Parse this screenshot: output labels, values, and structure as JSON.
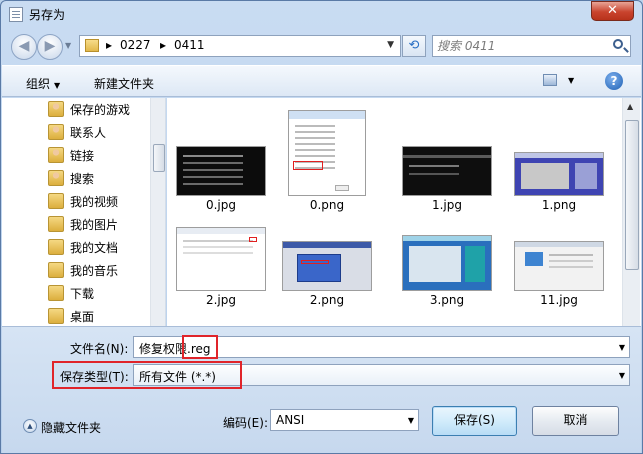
{
  "window": {
    "title": "另存为",
    "close": "✕"
  },
  "nav": {
    "back": "◀",
    "forward": "▶",
    "history_drop": "▼",
    "path": [
      "0227",
      "0411"
    ],
    "sep": "▸",
    "refresh": "⟲",
    "search_placeholder": "搜索 0411"
  },
  "toolbar": {
    "organize": "组织",
    "new_folder": "新建文件夹",
    "help": "?"
  },
  "sidebar": {
    "items": [
      {
        "label": "保存的游戏",
        "icon": "saved-games-icon"
      },
      {
        "label": "联系人",
        "icon": "contacts-icon"
      },
      {
        "label": "链接",
        "icon": "links-icon"
      },
      {
        "label": "搜索",
        "icon": "searches-icon"
      },
      {
        "label": "我的视频",
        "icon": "videos-icon"
      },
      {
        "label": "我的图片",
        "icon": "pictures-icon"
      },
      {
        "label": "我的文档",
        "icon": "documents-icon"
      },
      {
        "label": "我的音乐",
        "icon": "music-icon"
      },
      {
        "label": "下载",
        "icon": "downloads-icon"
      },
      {
        "label": "桌面",
        "icon": "desktop-icon"
      }
    ]
  },
  "files": [
    {
      "name": "0.jpg",
      "thumb": "dark"
    },
    {
      "name": "0.png",
      "thumb": "dialog"
    },
    {
      "name": "1.jpg",
      "thumb": "dark"
    },
    {
      "name": "1.png",
      "thumb": "bios"
    },
    {
      "name": "2.jpg",
      "thumb": "white"
    },
    {
      "name": "2.png",
      "thumb": "bluewin"
    },
    {
      "name": "3.png",
      "thumb": "setup"
    },
    {
      "name": "11.jpg",
      "thumb": "msgbox"
    }
  ],
  "form": {
    "filename_label": "文件名(N):",
    "filename_value": "修复权限.reg",
    "filetype_label": "保存类型(T):",
    "filetype_value": "所有文件 (*.*)",
    "encoding_label": "编码(E):",
    "encoding_value": "ANSI",
    "hide_folders": "隐藏文件夹",
    "save": "保存(S)",
    "cancel": "取消"
  }
}
